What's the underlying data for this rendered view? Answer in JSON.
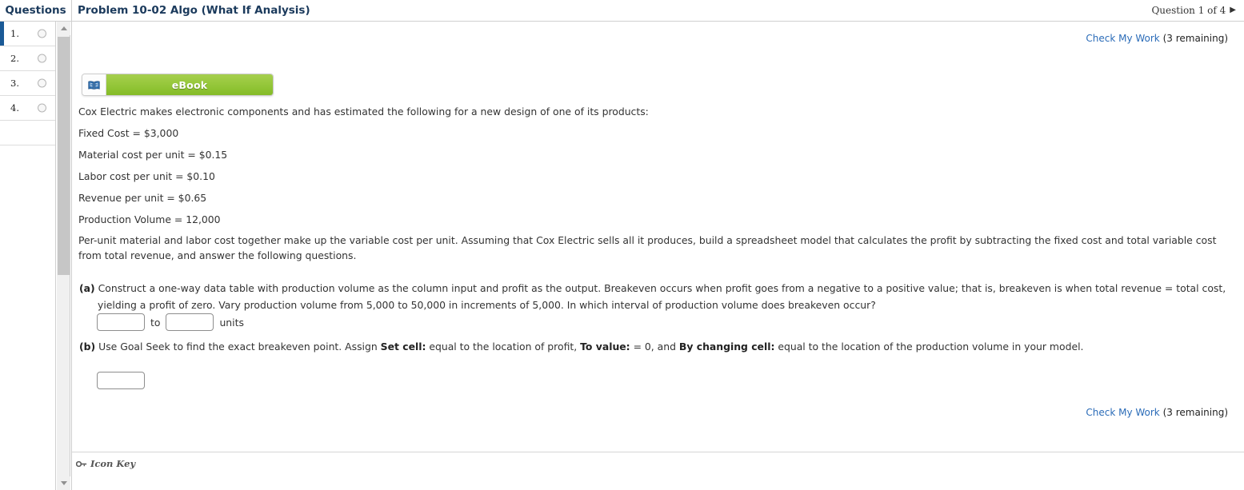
{
  "header": {
    "questions_label": "Questions",
    "problem_title": "Problem 10-02 Algo (What If Analysis)",
    "question_nav": "Question 1 of 4",
    "next_arrow_glyph": "▶"
  },
  "sidebar": {
    "items": [
      {
        "number": "1.",
        "active": true
      },
      {
        "number": "2.",
        "active": false
      },
      {
        "number": "3.",
        "active": false
      },
      {
        "number": "4.",
        "active": false
      }
    ]
  },
  "check_my_work": {
    "link_label": "Check My Work",
    "remaining_label": "(3 remaining)"
  },
  "ebook": {
    "label": "eBook",
    "icon": "open-book-icon",
    "button_color": "#95c73a"
  },
  "problem": {
    "intro": "Cox Electric makes electronic components and has estimated the following for a new design of one of its products:",
    "givens": [
      "Fixed Cost = $3,000",
      "Material cost per unit = $0.15",
      "Labor cost per unit = $0.10",
      "Revenue per unit = $0.65",
      "Production Volume = 12,000"
    ],
    "description": "Per-unit material and labor cost together make up the variable cost per unit. Assuming that Cox Electric sells all it produces, build a spreadsheet model that calculates the profit by subtracting the fixed cost and total variable cost from total revenue, and answer the following questions.",
    "parts": [
      {
        "label": "(a)",
        "text_line1": "Construct a one-way data table with production volume as the column input and profit as the output. Breakeven occurs when profit goes from a negative to a positive value; that is, breakeven is when total revenue = total cost,",
        "text_line2": "yielding a profit of zero. Vary production volume from 5,000 to 50,000 in increments of 5,000. In which interval of production volume does breakeven occur?",
        "answer": {
          "input_1_value": "",
          "input_2_value": "",
          "separator_label": "to",
          "unit_label": "units"
        }
      },
      {
        "label": "(b)",
        "text_pre": "Use Goal Seek to find the exact breakeven point. Assign ",
        "bold_1": "Set cell:",
        "text_mid_1": " equal to the location of profit, ",
        "bold_2": "To value:",
        "text_mid_2": " = 0, and ",
        "bold_3": "By changing cell:",
        "text_post": " equal to the location of the production volume in your model.",
        "answer": {
          "input_1_value": ""
        }
      }
    ]
  },
  "footer": {
    "icon_key_label": "Icon Key",
    "icon_key_glyph": "⮂"
  },
  "colors": {
    "link_blue": "#2b6cb8",
    "active_marker": "#1a5a96",
    "header_text": "#1b3a5c",
    "green": "#95c73a"
  }
}
